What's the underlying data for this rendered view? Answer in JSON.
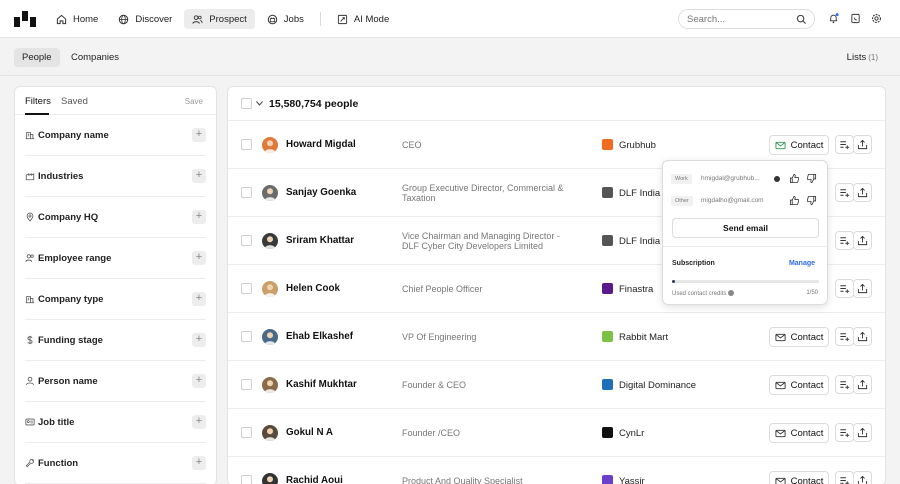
{
  "nav": {
    "items": [
      {
        "label": "Home",
        "icon": "home-icon"
      },
      {
        "label": "Discover",
        "icon": "globe-icon"
      },
      {
        "label": "Prospect",
        "icon": "users-icon",
        "active": true
      },
      {
        "label": "Jobs",
        "icon": "briefcase-icon"
      },
      {
        "label": "AI Mode",
        "icon": "sparkle-icon"
      }
    ],
    "search_placeholder": "Search..."
  },
  "subnav": {
    "tabs": [
      {
        "label": "People",
        "active": true
      },
      {
        "label": "Companies"
      }
    ],
    "lists_label": "Lists",
    "lists_count": "(1)"
  },
  "filters": {
    "tabs": [
      "Filters",
      "Saved"
    ],
    "save_label": "Save",
    "items": [
      {
        "label": "Company name",
        "icon": "building-icon"
      },
      {
        "label": "Industries",
        "icon": "factory-icon"
      },
      {
        "label": "Company HQ",
        "icon": "location-pin-icon"
      },
      {
        "label": "Employee range",
        "icon": "people-icon"
      },
      {
        "label": "Company type",
        "icon": "building-icon"
      },
      {
        "label": "Funding stage",
        "icon": "dollar-icon"
      },
      {
        "label": "Person name",
        "icon": "person-icon"
      },
      {
        "label": "Job title",
        "icon": "id-card-icon"
      },
      {
        "label": "Function",
        "icon": "wrench-icon"
      }
    ]
  },
  "results": {
    "count_label": "15,580,754 people",
    "contact_label": "Contact",
    "rows": [
      {
        "name": "Howard Migdal",
        "title": "CEO",
        "company": "Grubhub",
        "company_color": "#f26b21",
        "avatar_color": "#e07a3a"
      },
      {
        "name": "Sanjay Goenka",
        "title": "Group Executive Director, Commercial & Taxation",
        "company": "DLF India",
        "company_color": "#555555",
        "avatar_color": "#6b6b6b"
      },
      {
        "name": "Sriram Khattar",
        "title": "Vice Chairman and Managing Director - DLF Cyber City Developers Limited",
        "company": "DLF India",
        "company_color": "#555555",
        "avatar_color": "#3a3a3a"
      },
      {
        "name": "Helen Cook",
        "title": "Chief People Officer",
        "company": "Finastra",
        "company_color": "#5a1a8c",
        "avatar_color": "#c9a06b"
      },
      {
        "name": "Ehab Elkashef",
        "title": "VP Of Engineering",
        "company": "Rabbit Mart",
        "company_color": "#7cc242",
        "avatar_color": "#4a6a8a"
      },
      {
        "name": "Kashif Mukhtar",
        "title": "Founder & CEO",
        "company": "Digital Dominance",
        "company_color": "#1e6fb8",
        "avatar_color": "#8a6b4a"
      },
      {
        "name": "Gokul N A",
        "title": "Founder /CEO",
        "company": "CynLr",
        "company_color": "#111111",
        "avatar_color": "#5a4a3a"
      },
      {
        "name": "Rachid Aoui",
        "title": "Product And Quality Specialist",
        "company": "Yassir",
        "company_color": "#6a3fc9",
        "avatar_color": "#333333"
      }
    ]
  },
  "popup": {
    "work_tag": "Work",
    "work_email": "hmigdal@grubhub...",
    "other_tag": "Other",
    "other_email": "migdalho@gmail.com",
    "send_label": "Send email",
    "subscription_label": "Subscription",
    "manage_label": "Manage",
    "used_label": "Used contact credits",
    "used_count": "1/50",
    "used_fraction": 0.02
  }
}
